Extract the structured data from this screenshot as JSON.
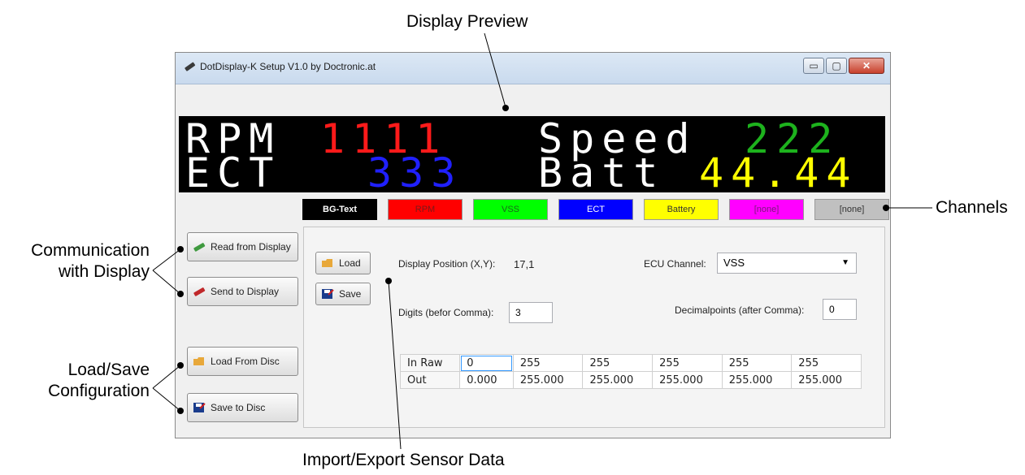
{
  "callouts": {
    "display_preview": "Display Preview",
    "channels": "Channels",
    "communication": "Communication\nwith Display",
    "communication_line1": "Communication",
    "communication_line2": "with Display",
    "loadsave_line1": "Load/Save",
    "loadsave_line2": "Configuration",
    "import_export": "Import/Export Sensor Data"
  },
  "window": {
    "title": "DotDisplay-K Setup V1.0 by Doctronic.at",
    "min_label": "▭",
    "max_label": "▢",
    "close_label": "✕"
  },
  "display": {
    "row1": {
      "label1": "RPM",
      "value1": "1111",
      "label2": "Speed",
      "value2": "222"
    },
    "row2": {
      "label1": "ECT",
      "value1": "333",
      "label2": "Batt",
      "value2": "44.44"
    }
  },
  "channels": [
    {
      "label": "BG-Text",
      "bg": "#000000",
      "fg": "#ffffff"
    },
    {
      "label": "RPM",
      "bg": "#ff0000",
      "fg": "#7a1a1a"
    },
    {
      "label": "VSS",
      "bg": "#00ff00",
      "fg": "#1a6a1a"
    },
    {
      "label": "ECT",
      "bg": "#0000ff",
      "fg": "#ffffff"
    },
    {
      "label": "Battery",
      "bg": "#ffff00",
      "fg": "#333333"
    },
    {
      "label": "[none]",
      "bg": "#ff00ff",
      "fg": "#7a1a7a"
    },
    {
      "label": "[none]",
      "bg": "#c0c0c0",
      "fg": "#333333"
    }
  ],
  "side_buttons": {
    "read": "Read from Display",
    "send": "Send to Display",
    "load_disc": "Load From Disc",
    "save_disc": "Save to Disc"
  },
  "panel": {
    "load": "Load",
    "save": "Save",
    "display_position_label": "Display Position (X,Y):",
    "display_position_value": "17,1",
    "ecu_channel_label": "ECU Channel:",
    "ecu_channel_value": "VSS",
    "digits_label": "Digits (befor Comma):",
    "digits_value": "3",
    "decimal_label": "Decimalpoints (after Comma):",
    "decimal_value": "0"
  },
  "table": {
    "rows": [
      {
        "name": "In Raw",
        "cells": [
          "0",
          "255",
          "255",
          "255",
          "255",
          "255"
        ]
      },
      {
        "name": "Out",
        "cells": [
          "0.000",
          "255.000",
          "255.000",
          "255.000",
          "255.000",
          "255.000"
        ]
      }
    ]
  },
  "colors": {
    "rpm": "#ff1a1a",
    "speed": "#1db21d",
    "ect": "#2020ff",
    "batt": "#ffff00",
    "label_text": "#ffffff"
  }
}
